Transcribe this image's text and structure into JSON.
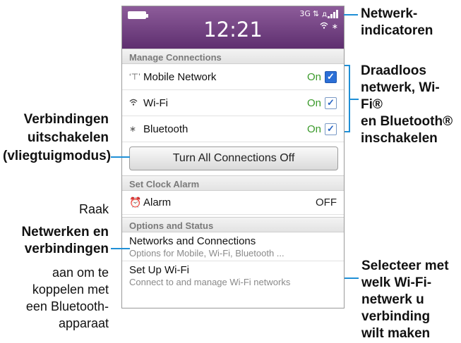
{
  "statusbar": {
    "time": "12:21",
    "network_type": "3G",
    "data_icon": "data-transfer-icon",
    "signal_icon": "signal-bars-icon",
    "wifi_icon": "wifi-icon",
    "bluetooth_icon": "bluetooth-icon",
    "background_color": "#6b3a7d"
  },
  "manage_connections": {
    "header": "Manage Connections",
    "items": [
      {
        "label": "Mobile Network",
        "state": "On",
        "checked": true,
        "icon": "antenna-icon"
      },
      {
        "label": "Wi-Fi",
        "state": "On",
        "checked": true,
        "icon": "wifi-icon"
      },
      {
        "label": "Bluetooth",
        "state": "On",
        "checked": true,
        "icon": "bluetooth-icon"
      }
    ],
    "turn_off_button": "Turn All Connections Off"
  },
  "clock_alarm": {
    "header": "Set Clock Alarm",
    "label": "Alarm",
    "state": "OFF",
    "icon": "alarm-clock-icon"
  },
  "options_status": {
    "header": "Options and Status",
    "items": [
      {
        "title": "Networks and Connections",
        "subtitle": "Options for Mobile, Wi-Fi, Bluetooth ..."
      },
      {
        "title": "Set Up Wi-Fi",
        "subtitle": "Connect to and manage Wi-Fi networks"
      }
    ]
  },
  "callouts": {
    "network_indicators": [
      "Netwerk-",
      "indicatoren"
    ],
    "enable": [
      "Draadloos",
      "netwerk, Wi-Fi®",
      "en Bluetooth®",
      "inschakelen"
    ],
    "disable": [
      "Verbindingen",
      "uitschakelen",
      "(vliegtuigmodus)"
    ],
    "tap_prefix": "Raak",
    "networks": [
      "Netwerken en",
      "verbindingen"
    ],
    "tap_suffix": [
      "aan om te",
      "koppelen met",
      "een Bluetooth-",
      "apparaat"
    ],
    "select_wifi": [
      "Selecteer met",
      "welk Wi-Fi-",
      "netwerk u",
      "verbinding",
      "wilt maken"
    ],
    "line_color": "#1f8fd6"
  }
}
